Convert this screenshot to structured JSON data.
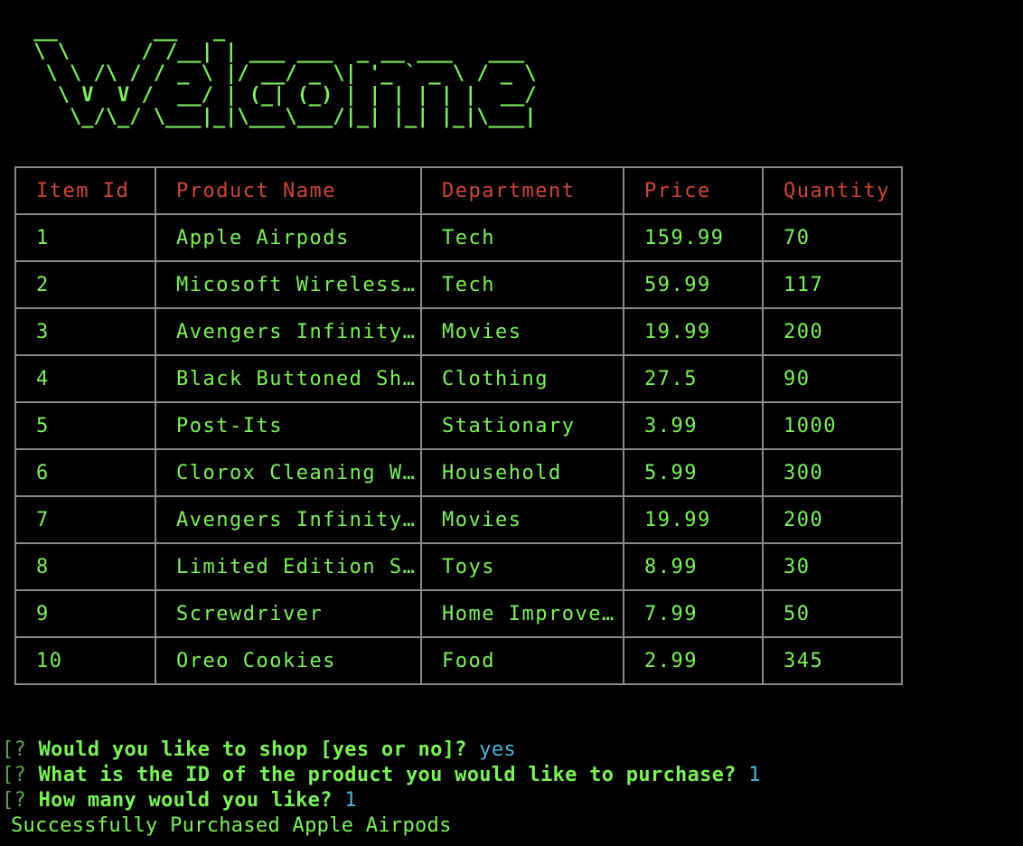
{
  "banner": {
    "ascii_art": " __        __   _\n \\ \\      / /__| | ___ ___  _ __ ___   ___\n  \\ \\ /\\ / / _ \\ |/ __/ _ \\| '_ ` _ \\ / _ \\\n   \\ V  V /  __/ | (_| (_) | | | | | |  __/\n    \\_/\\_/ \\___|_|\\___\\___/|_| |_| |_|\\___|",
    "text": "Welcome"
  },
  "table": {
    "headers": [
      "Item Id",
      "Product Name",
      "Department",
      "Price",
      "Quantity"
    ],
    "rows": [
      [
        "1",
        "Apple Airpods",
        "Tech",
        "159.99",
        "70"
      ],
      [
        "2",
        "Micosoft Wireless…",
        "Tech",
        "59.99",
        "117"
      ],
      [
        "3",
        "Avengers Infinity…",
        "Movies",
        "19.99",
        "200"
      ],
      [
        "4",
        "Black Buttoned Sh…",
        "Clothing",
        "27.5",
        "90"
      ],
      [
        "5",
        "Post-Its",
        "Stationary",
        "3.99",
        "1000"
      ],
      [
        "6",
        "Clorox Cleaning W…",
        "Household",
        "5.99",
        "300"
      ],
      [
        "7",
        "Avengers Infinity…",
        "Movies",
        "19.99",
        "200"
      ],
      [
        "8",
        "Limited Edition S…",
        "Toys",
        "8.99",
        "30"
      ],
      [
        "9",
        "Screwdriver",
        "Home Improve…",
        "7.99",
        "50"
      ],
      [
        "10",
        "Oreo Cookies",
        "Food",
        "2.99",
        "345"
      ]
    ]
  },
  "console": {
    "prompt_mark": "[?",
    "prompts": [
      {
        "question": "Would you like to shop [yes or no]?",
        "answer": "yes"
      },
      {
        "question": "What is the ID of the product you would like to purchase?",
        "answer": "1"
      },
      {
        "question": "How many would you like?",
        "answer": "1"
      }
    ],
    "result": "Successfully Purchased Apple Airpods"
  },
  "colors": {
    "background": "#000000",
    "text_green": "#7CF25B",
    "header_red": "#D0463A",
    "answer_blue": "#4FB3D9",
    "border_gray": "#8a8a8a"
  }
}
